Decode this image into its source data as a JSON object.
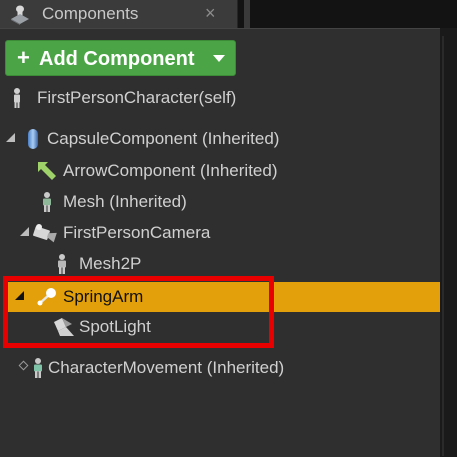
{
  "tab": {
    "title": "Components",
    "close_glyph": "×",
    "icon": "components-icon"
  },
  "toolbar": {
    "add_component_label": "Add Component",
    "add_plus_glyph": "+"
  },
  "tree": {
    "root": {
      "label": "FirstPersonCharacter(self)",
      "icon": "character-icon"
    },
    "capsule": {
      "label": "CapsuleComponent (Inherited)",
      "icon": "capsule-icon"
    },
    "arrow": {
      "label": "ArrowComponent (Inherited)",
      "icon": "arrow-icon"
    },
    "mesh": {
      "label": "Mesh (Inherited)",
      "icon": "mesh-icon"
    },
    "camera": {
      "label": "FirstPersonCamera",
      "icon": "camera-icon"
    },
    "mesh2p": {
      "label": "Mesh2P",
      "icon": "mesh-icon"
    },
    "springarm": {
      "label": "SpringArm",
      "icon": "spring-arm-icon",
      "selected": true
    },
    "spotlight": {
      "label": "SpotLight",
      "icon": "spotlight-icon"
    },
    "movement": {
      "label": "CharacterMovement (Inherited)",
      "icon": "character-movement-icon"
    }
  },
  "colors": {
    "selection": "#e3a00b",
    "add_button": "#4ba445",
    "highlight_box": "#e80000",
    "panel_bg": "#2f2f2f"
  }
}
